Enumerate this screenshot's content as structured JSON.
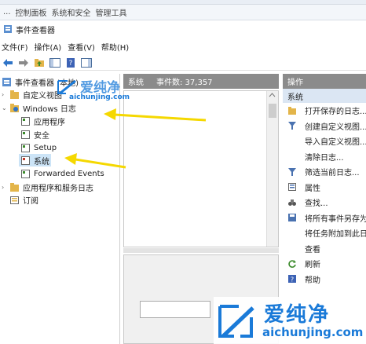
{
  "address_bar": {
    "c1": "...",
    "c2": "控制面板",
    "c3": "系统和安全",
    "c4": "管理工具"
  },
  "window": {
    "title": "事件查看器"
  },
  "menu": {
    "file": "文件(F)",
    "action": "操作(A)",
    "view": "查看(V)",
    "help": "帮助(H)"
  },
  "tree": {
    "root": "事件查看器 (本地)",
    "custom_views": "自定义视图",
    "windows_logs": "Windows 日志",
    "application": "应用程序",
    "security": "安全",
    "setup": "Setup",
    "system": "系统",
    "forwarded": "Forwarded Events",
    "app_service_logs": "应用程序和服务日志",
    "subscriptions": "订阅"
  },
  "middle": {
    "header_name": "系统",
    "header_count": "事件数: 37,357"
  },
  "actions": {
    "header": "操作",
    "section": "系统",
    "items": [
      {
        "label": "打开保存的日志...",
        "icon": "folder-open-icon"
      },
      {
        "label": "创建自定义视图...",
        "icon": "filter-icon"
      },
      {
        "label": "导入自定义视图...",
        "icon": "blank"
      },
      {
        "label": "清除日志...",
        "icon": "blank"
      },
      {
        "label": "筛选当前日志...",
        "icon": "filter-icon"
      },
      {
        "label": "属性",
        "icon": "properties-icon"
      },
      {
        "label": "查找...",
        "icon": "binoculars-icon"
      },
      {
        "label": "将所有事件另存为...",
        "icon": "save-icon"
      },
      {
        "label": "将任务附加到此日志...",
        "icon": "blank"
      },
      {
        "label": "查看",
        "icon": "blank"
      },
      {
        "label": "刷新",
        "icon": "refresh-icon"
      },
      {
        "label": "帮助",
        "icon": "help-icon"
      }
    ]
  },
  "watermark": {
    "brand": "爱纯净",
    "url": "aichunjing.com"
  },
  "colors": {
    "arrow": "#f5d800",
    "header_gray": "#8b8b8b",
    "selection": "#cce4f7",
    "brand_blue": "#1a7ad8"
  }
}
